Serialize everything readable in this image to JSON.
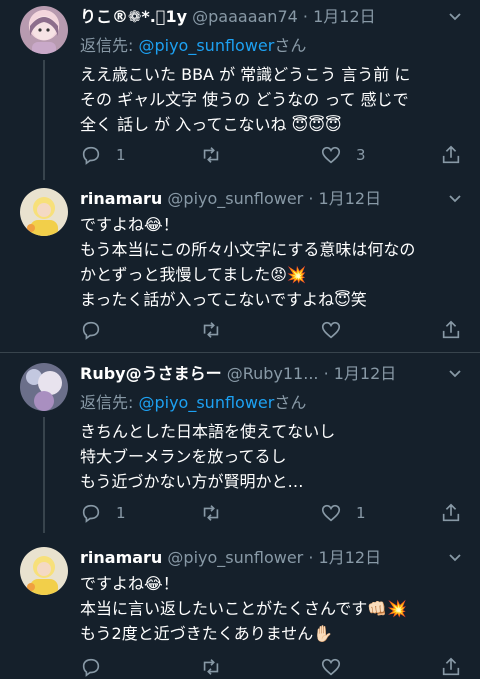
{
  "tweets": [
    {
      "name": "りこ®︎❁*.ﾟ1y",
      "handle": "@paaaaan74",
      "date": "1月12日",
      "reply_prefix": "返信先: ",
      "reply_to": "@piyo_sunflower",
      "reply_suffix": "さん",
      "text": "ええ歳こいた BBA が 常識どうこう 言う前 に\nその ギャル文字 使うの どうなの って 感じで\n全く 話し が 入ってこないね 😇😇😇",
      "replies": "1",
      "retweets": "",
      "likes": "3"
    },
    {
      "name": "rinamaru",
      "handle": "@piyo_sunflower",
      "date": "1月12日",
      "text": "ですよね😂！\nもう本当にこの所々小文字にする意味は何なの\nかとずっと我慢してました😡💥\nまったく話が入ってこないですよね😇笑",
      "replies": "",
      "retweets": "",
      "likes": ""
    },
    {
      "name": "Ruby@うさまらー",
      "handle": "@Ruby11...",
      "date": "1月12日",
      "reply_prefix": "返信先: ",
      "reply_to": "@piyo_sunflower",
      "reply_suffix": "さん",
      "text": "きちんとした日本語を使えてないし\n特大ブーメランを放ってるし\nもう近づかない方が賢明かと…",
      "replies": "1",
      "retweets": "",
      "likes": "1"
    },
    {
      "name": "rinamaru",
      "handle": "@piyo_sunflower",
      "date": "1月12日",
      "text": "ですよね😂！\n本当に言い返したいことがたくさんです👊🏻💥\nもう2度と近づきたくありません✋🏻",
      "replies": "",
      "retweets": "",
      "likes": ""
    }
  ],
  "separator": " · ",
  "colors": {
    "background": "#15202b",
    "secondary": "#8899a6",
    "accent": "#1da1f2",
    "border": "#38444d"
  }
}
